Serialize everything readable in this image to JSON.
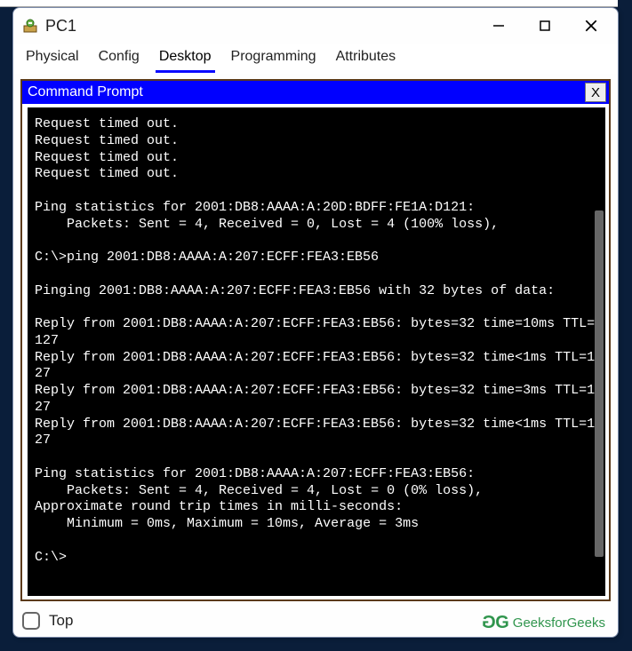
{
  "window": {
    "title": "PC1"
  },
  "tabs": [
    "Physical",
    "Config",
    "Desktop",
    "Programming",
    "Attributes"
  ],
  "active_tab_index": 2,
  "cmd": {
    "title": "Command Prompt",
    "close_label": "X"
  },
  "terminal_lines": [
    "Request timed out.",
    "Request timed out.",
    "Request timed out.",
    "Request timed out.",
    "",
    "Ping statistics for 2001:DB8:AAAA:A:20D:BDFF:FE1A:D121:",
    "    Packets: Sent = 4, Received = 0, Lost = 4 (100% loss),",
    "",
    "C:\\>ping 2001:DB8:AAAA:A:207:ECFF:FEA3:EB56",
    "",
    "Pinging 2001:DB8:AAAA:A:207:ECFF:FEA3:EB56 with 32 bytes of data:",
    "",
    "Reply from 2001:DB8:AAAA:A:207:ECFF:FEA3:EB56: bytes=32 time=10ms TTL=127",
    "Reply from 2001:DB8:AAAA:A:207:ECFF:FEA3:EB56: bytes=32 time<1ms TTL=127",
    "Reply from 2001:DB8:AAAA:A:207:ECFF:FEA3:EB56: bytes=32 time=3ms TTL=127",
    "Reply from 2001:DB8:AAAA:A:207:ECFF:FEA3:EB56: bytes=32 time<1ms TTL=127",
    "",
    "Ping statistics for 2001:DB8:AAAA:A:207:ECFF:FEA3:EB56:",
    "    Packets: Sent = 4, Received = 4, Lost = 0 (0% loss),",
    "Approximate round trip times in milli-seconds:",
    "    Minimum = 0ms, Maximum = 10ms, Average = 3ms",
    "",
    "C:\\>"
  ],
  "footer": {
    "top_label": "Top"
  },
  "watermark": {
    "text": "GeeksforGeeks"
  }
}
